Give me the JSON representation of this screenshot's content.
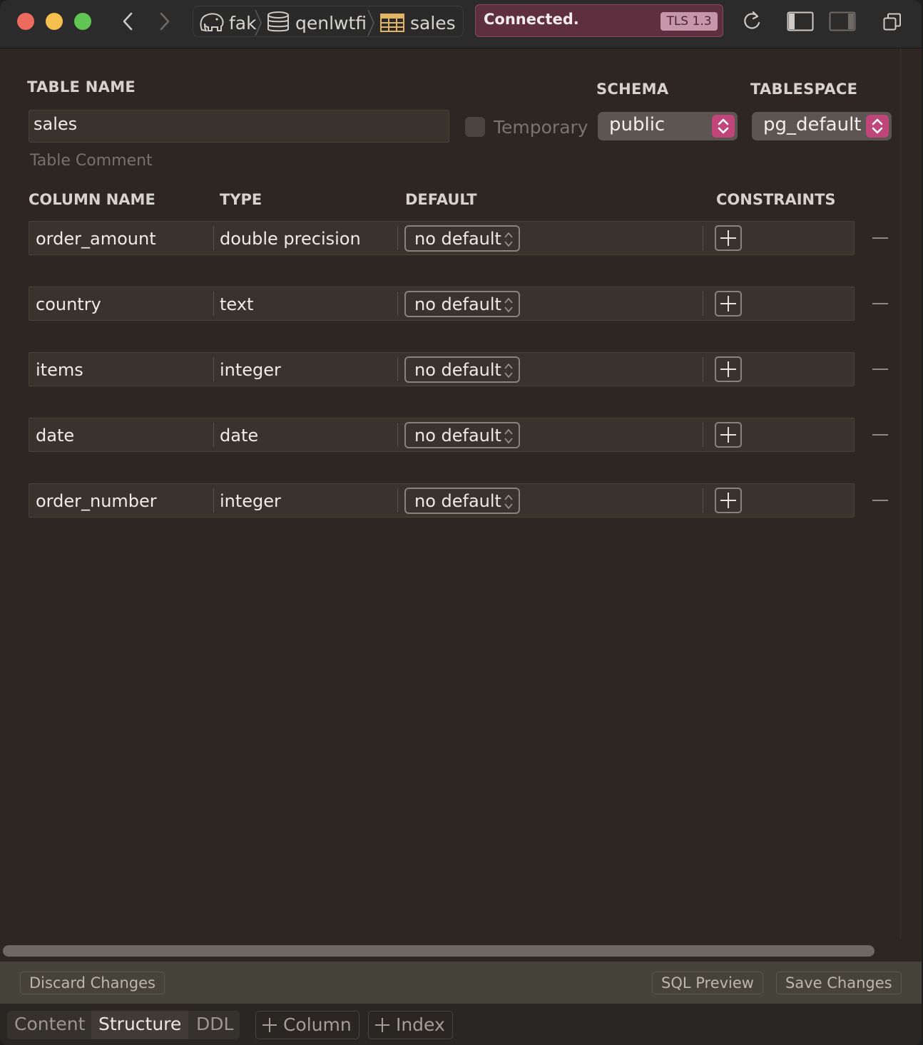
{
  "breadcrumbs": [
    {
      "label": "fak",
      "icon": "elephant-icon"
    },
    {
      "label": "qenlwtfi",
      "icon": "database-icon"
    },
    {
      "label": "sales",
      "icon": "table-icon"
    }
  ],
  "status": {
    "text": "Connected.",
    "badge": "TLS 1.3"
  },
  "form": {
    "table_name_label": "TABLE NAME",
    "table_name_value": "sales",
    "temporary_label": "Temporary",
    "schema_label": "SCHEMA",
    "schema_value": "public",
    "tablespace_label": "TABLESPACE",
    "tablespace_value": "pg_default",
    "comment_placeholder": "Table Comment"
  },
  "columns_header": {
    "name": "COLUMN NAME",
    "type": "TYPE",
    "default": "DEFAULT",
    "constraints": "CONSTRAINTS"
  },
  "columns": [
    {
      "name": "order_amount",
      "type": "double precision",
      "default": "no default"
    },
    {
      "name": "country",
      "type": "text",
      "default": "no default"
    },
    {
      "name": "items",
      "type": "integer",
      "default": "no default"
    },
    {
      "name": "date",
      "type": "date",
      "default": "no default"
    },
    {
      "name": "order_number",
      "type": "integer",
      "default": "no default"
    }
  ],
  "actions": {
    "discard": "Discard Changes",
    "sql_preview": "SQL Preview",
    "save": "Save Changes"
  },
  "tabs": {
    "content": "Content",
    "structure": "Structure",
    "ddl": "DDL",
    "add_column": "Column",
    "add_index": "Index"
  },
  "colors": {
    "accent": "#c0457a",
    "status_bg": "#5e2f3f",
    "background": "#2e2622"
  }
}
